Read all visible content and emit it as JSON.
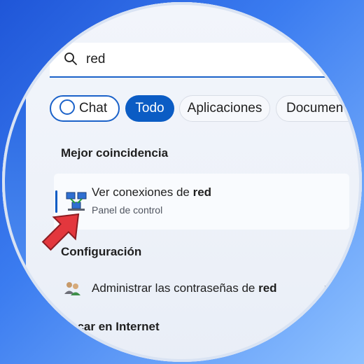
{
  "search": {
    "query": "red"
  },
  "filters": [
    {
      "label": "Chat"
    },
    {
      "label": "Todo"
    },
    {
      "label": "Aplicaciones"
    },
    {
      "label": "Document"
    }
  ],
  "sections": {
    "best_match": "Mejor coincidencia",
    "settings": "Configuración",
    "internet": "scar en Internet"
  },
  "best_match_item": {
    "title_prefix": "Ver conexiones de ",
    "title_bold": "red",
    "subtitle": "Panel de control"
  },
  "settings_item": {
    "label_prefix": "Administrar las contraseñas de ",
    "label_bold": "red"
  },
  "colors": {
    "accent": "#0b5cc4",
    "arrow": "#e3373d"
  }
}
